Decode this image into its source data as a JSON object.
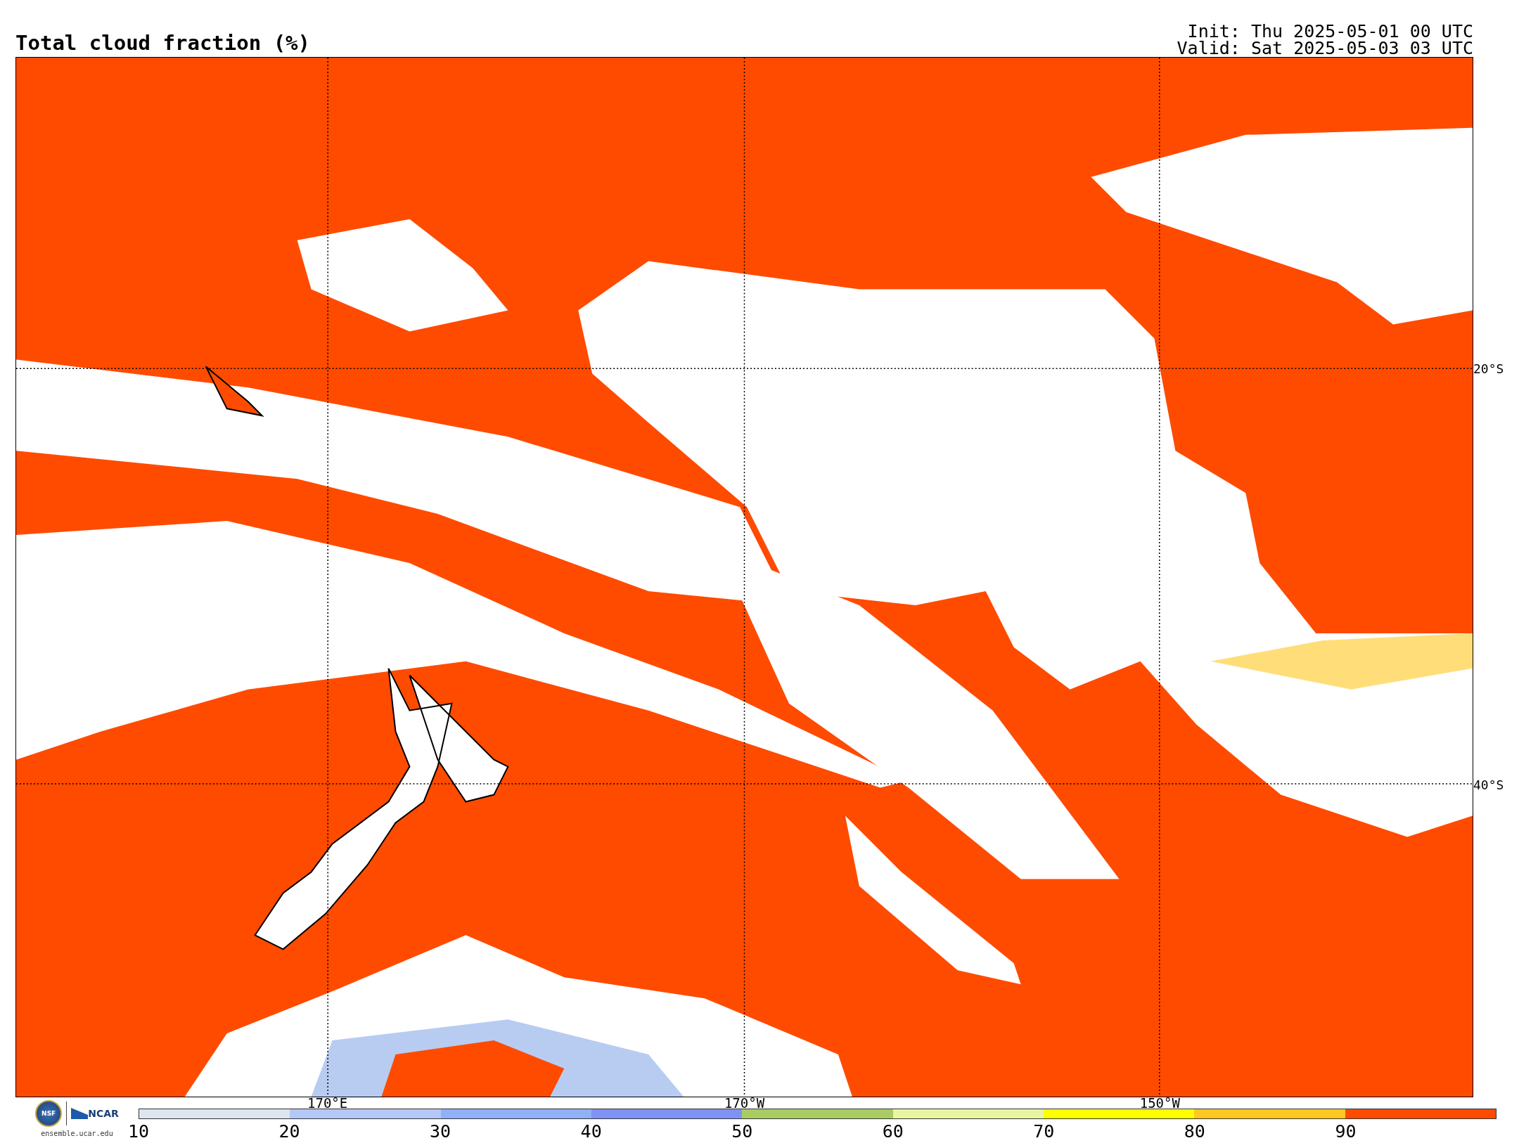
{
  "title": "Total cloud fraction (%)",
  "run_info": [
    "Init: Thu 2025-05-01 00 UTC",
    "Valid: Sat 2025-05-03 03 UTC"
  ],
  "map": {
    "latitude_labels": [
      "20°S",
      "40°S"
    ],
    "longitude_labels": [
      "170°E",
      "170°W",
      "150°W"
    ]
  },
  "logos": {
    "nsf": "NSF",
    "ncar": "NCAR",
    "website": "ensemble.ucar.edu"
  },
  "colorbar": {
    "bins": [
      {
        "color": "#dde6ee"
      },
      {
        "color": "#b4c8f7"
      },
      {
        "color": "#90b0f7"
      },
      {
        "color": "#7f92f3"
      },
      {
        "color": "#a8cc62"
      },
      {
        "color": "#e8f5a2"
      },
      {
        "color": "#ffff00"
      },
      {
        "color": "#ffc820"
      },
      {
        "color": "#ff4b00"
      }
    ],
    "ticks": [
      "10",
      "20",
      "30",
      "40",
      "50",
      "60",
      "70",
      "80",
      "90"
    ]
  }
}
